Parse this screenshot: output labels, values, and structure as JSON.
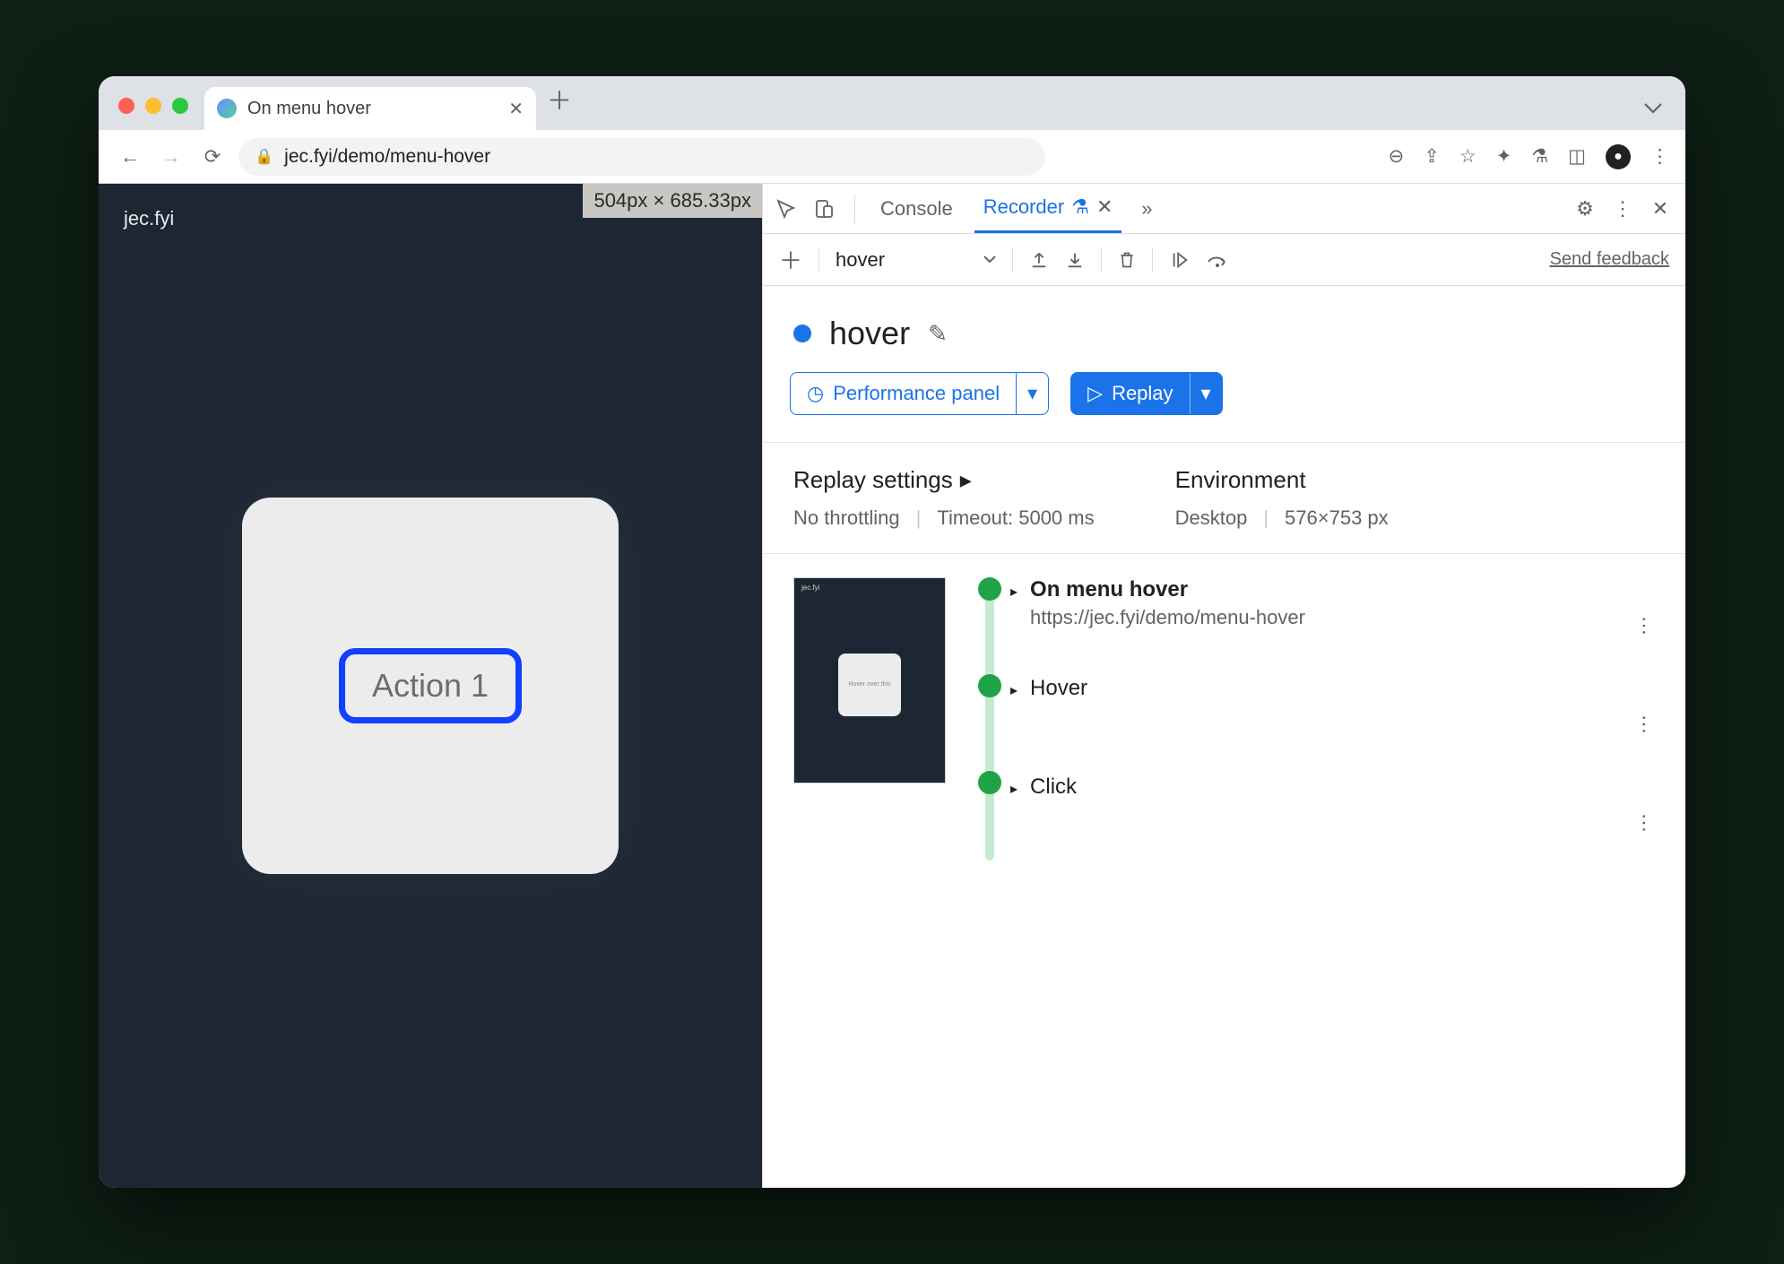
{
  "browser": {
    "tab_title": "On menu hover",
    "url": "jec.fyi/demo/menu-hover"
  },
  "page": {
    "brand": "jec.fyi",
    "size_badge": "504px × 685.33px",
    "action_button": "Action 1"
  },
  "devtools": {
    "tabs": {
      "console": "Console",
      "recorder": "Recorder"
    },
    "subbar": {
      "selected": "hover",
      "feedback": "Send feedback"
    },
    "recording": {
      "title": "hover",
      "perf_btn": "Performance panel",
      "replay_btn": "Replay"
    },
    "settings": {
      "replay_head": "Replay settings",
      "throttling": "No throttling",
      "timeout": "Timeout: 5000 ms",
      "env_head": "Environment",
      "device": "Desktop",
      "dims": "576×753 px"
    },
    "steps": [
      {
        "title": "On menu hover",
        "sub": "https://jec.fyi/demo/menu-hover",
        "bold": true
      },
      {
        "title": "Hover",
        "sub": "",
        "bold": false
      },
      {
        "title": "Click",
        "sub": "",
        "bold": false
      }
    ],
    "thumb_label": "Hover over this"
  }
}
